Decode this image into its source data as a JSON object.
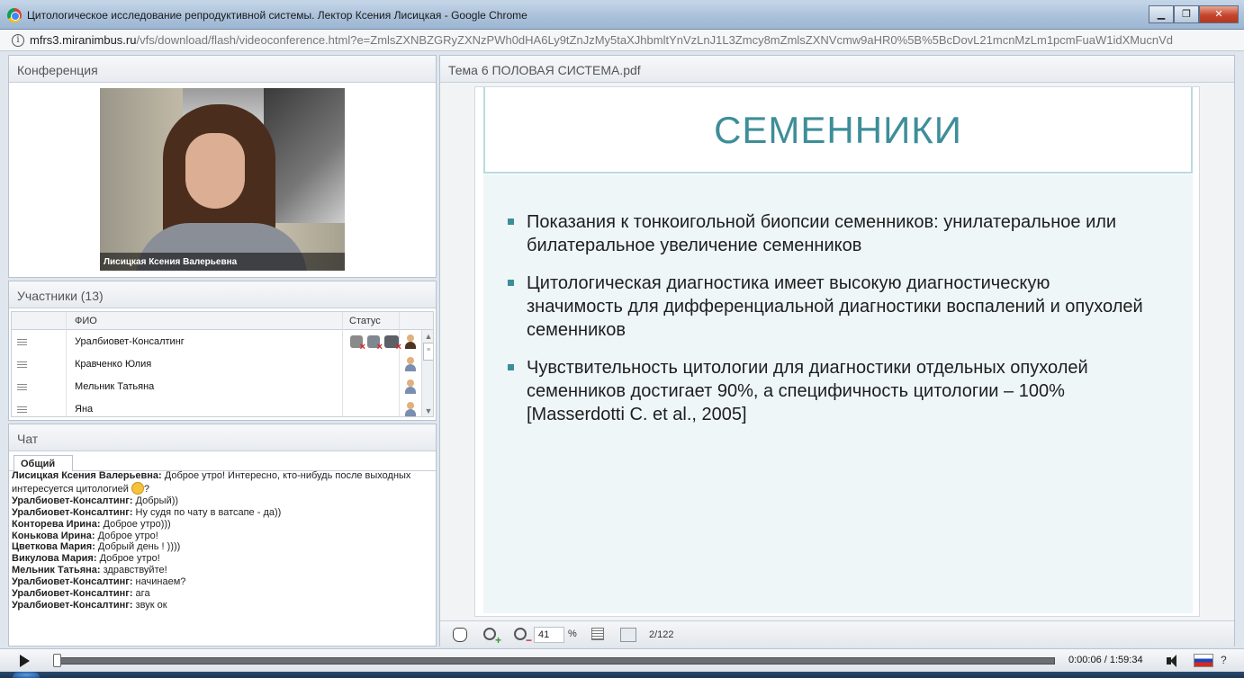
{
  "window": {
    "title": "Цитологическое исследование репродуктивной системы. Лектор Ксения Лисицкая - Google Chrome",
    "minimize": "▁",
    "restore": "❐",
    "close": "✕"
  },
  "address": {
    "info": "i",
    "host": "mfrs3.miranimbus.ru",
    "path": "/vfs/download/flash/videoconference.html?e=ZmlsZXNBZGRyZXNzPWh0dHA6Ly9tZnJzMy5taXJhbmltYnVzLnJ1L3Zmcy8mZmlsZXNVcmw9aHR0%5B%5BcDovL21mcnMzLm1pcmFuaW1idXMucnVd"
  },
  "conference": {
    "header": "Конференция",
    "video_caption": "Лисицкая Ксения  Валерьевна"
  },
  "participants": {
    "header": "Участники (13)",
    "col_name": "ФИО",
    "col_status": "Статус",
    "rows": [
      {
        "name": "Уралбиовет-Консалтинг"
      },
      {
        "name": "Кравченко Юлия"
      },
      {
        "name": "Мельник Татьяна"
      },
      {
        "name": "Яна"
      }
    ]
  },
  "chat": {
    "header": "Чат",
    "tab": "Общий",
    "messages": [
      {
        "author": "Лисицкая Ксения  Валерьевна:",
        "text": " Доброе утро! Интересно, кто-нибудь после выходных интересуется цитологией ",
        "tail": "?"
      },
      {
        "author": "Уралбиовет-Консалтинг:",
        "text": " Добрый))"
      },
      {
        "author": "Уралбиовет-Консалтинг:",
        "text": " Ну судя по чату в ватсапе - да))"
      },
      {
        "author": "Конторева Ирина:",
        "text": " Доброе утро)))"
      },
      {
        "author": "Конькова  Ирина:",
        "text": " Доброе утро!"
      },
      {
        "author": "Цветкова  Мария:",
        "text": " Добрый день ! ))))"
      },
      {
        "author": "Викулова Мария:",
        "text": " Доброе утро!"
      },
      {
        "author": "Мельник Татьяна:",
        "text": " здравствуйте!"
      },
      {
        "author": "Уралбиовет-Консалтинг:",
        "text": " начинаем?"
      },
      {
        "author": "Уралбиовет-Консалтинг:",
        "text": " ага"
      },
      {
        "author": "Уралбиовет-Консалтинг:",
        "text": " звук ок"
      }
    ]
  },
  "pdf": {
    "header": "Тема 6 ПОЛОВАЯ СИСТЕМА.pdf",
    "slide_title": "СЕМЕННИКИ",
    "bullets": [
      "Показания к тонкоигольной биопсии семенников: унилатеральное или билатеральное увеличение семенников",
      "Цитологическая диагностика имеет высокую диагностическую значимость для дифференциальной диагностики воспалений и опухолей семенников",
      "Чувствительность цитологии для диагностики отдельных опухолей семенников достигает 90%, а специфичность цитологии – 100% [Masserdotti C. et al., 2005]"
    ],
    "zoom": "41",
    "zoom_unit": "%",
    "page": "2/122"
  },
  "player": {
    "time": "0:00:06 / 1:59:34",
    "progress": 0.0008,
    "help": "?"
  },
  "colors": {
    "accent": "#3d8e99",
    "slide_bg": "#eef6f8"
  }
}
